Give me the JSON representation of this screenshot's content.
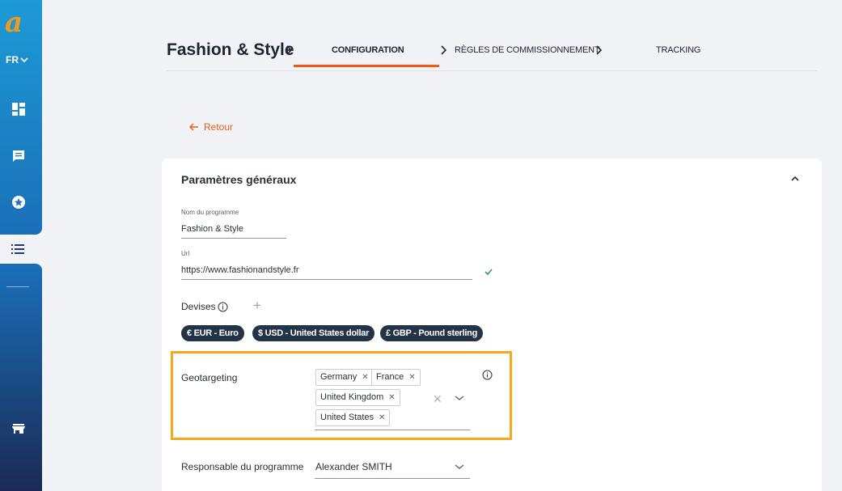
{
  "sidebar": {
    "language": "FR",
    "icons": [
      "dashboard-icon",
      "chat-icon",
      "star-badge-icon",
      "list-icon",
      "store-icon"
    ]
  },
  "header": {
    "title": "Fashion & Style",
    "steps": [
      "CONFIGURATION",
      "RÈGLES DE COMMISSIONNEMENT",
      "TRACKING"
    ],
    "active_step": "CONFIGURATION"
  },
  "back_link": "Retour",
  "card": {
    "title": "Paramètres généraux",
    "program_name": {
      "label": "Nom du programme",
      "value": "Fashion & Style"
    },
    "url": {
      "label": "Url",
      "value": "https://www.fashionandstyle.fr"
    },
    "currencies": {
      "label": "Devises",
      "items": [
        "€ EUR - Euro",
        "$ USD - United States dollar",
        "£ GBP - Pound sterling"
      ]
    },
    "geotargeting": {
      "label": "Geotargeting",
      "selected": [
        "Germany",
        "France",
        "United Kingdom",
        "United States"
      ]
    },
    "manager": {
      "label": "Responsable du programme",
      "value": "Alexander SMITH"
    }
  },
  "colors": {
    "accent": "#ec5a14",
    "highlight": "#f7a81b",
    "chip": "#243447",
    "sidebar_top": "#1d9bd6",
    "sidebar_bottom": "#1b2a55"
  }
}
